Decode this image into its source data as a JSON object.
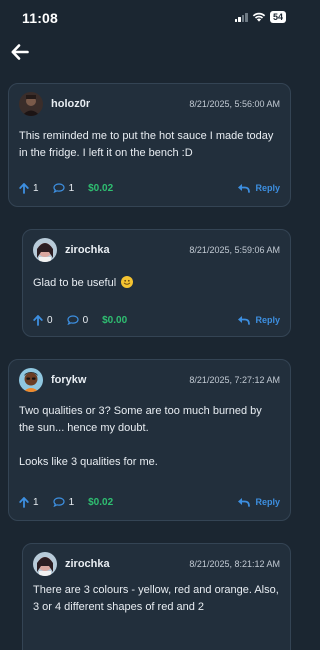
{
  "status_bar": {
    "time": "11:08",
    "battery": "54"
  },
  "comments": [
    {
      "username": "holoz0r",
      "timestamp": "8/21/2025, 5:56:00 AM",
      "paragraphs": [
        "This reminded me to put the hot sauce I made today in the fridge. I left it on the bench :D"
      ],
      "upvotes": "1",
      "replies": "1",
      "tip": "$0.02",
      "reply_label": "Reply"
    },
    {
      "username": "zirochka",
      "timestamp": "8/21/2025, 5:59:06 AM",
      "paragraphs": [
        "Glad to be useful"
      ],
      "upvotes": "0",
      "replies": "0",
      "tip": "$0.00",
      "reply_label": "Reply"
    },
    {
      "username": "forykw",
      "timestamp": "8/21/2025, 7:27:12 AM",
      "paragraphs": [
        "Two qualities or 3? Some are too much burned by the sun... hence my doubt.",
        "Looks like 3 qualities for me."
      ],
      "upvotes": "1",
      "replies": "1",
      "tip": "$0.02",
      "reply_label": "Reply"
    },
    {
      "username": "zirochka",
      "timestamp": "8/21/2025, 8:21:12 AM",
      "paragraphs": [
        "There are 3 colours - yellow, red and orange. Also, 3 or 4 different shapes of red and 2"
      ]
    }
  ],
  "colors": {
    "background": "#1b2631",
    "card": "#222f3c",
    "accent_blue": "#3d8fe0",
    "tip_green": "#2fbf71"
  },
  "icons": {
    "back": "arrow-left-icon",
    "upvote": "arrow-up-icon",
    "comment": "chat-bubble-icon",
    "reply": "reply-arrow-icon",
    "emoji": "smiling-face-emoji"
  }
}
